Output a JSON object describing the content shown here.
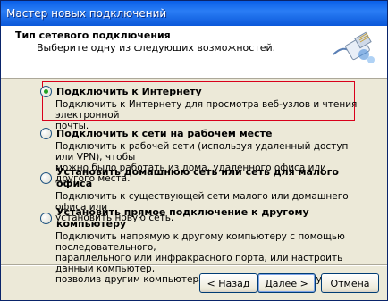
{
  "window": {
    "title": "Мастер новых подключений"
  },
  "header": {
    "title": "Тип сетевого подключения",
    "subtitle": "Выберите одну из следующих возможностей."
  },
  "options": [
    {
      "label": "Подключить к Интернету",
      "desc1": "Подключить к Интернету для просмотра веб-узлов и чтения  электронной",
      "desc2": "почты.",
      "desc3": "",
      "checked": true
    },
    {
      "label": "Подключить к сети на рабочем месте",
      "desc1": "Подключить к рабочей сети (используя удаленный доступ или VPN), чтобы",
      "desc2": "можно было работать из дома, удаленного офиса или другого места.",
      "desc3": "",
      "checked": false
    },
    {
      "label": "Установить домашнюю сеть или сеть для малого офиса",
      "desc1": "Подключить к существующей сети малого или домашнего офиса или",
      "desc2": "установить новую сеть.",
      "desc3": "",
      "checked": false
    },
    {
      "label": "Установить прямое подключение к другому компьютеру",
      "desc1": "Подключить напрямую к другому компьютеру с помощью последовательного,",
      "desc2": "параллельного или инфракрасного порта, или настроить данный компьютер,",
      "desc3": "позволив другим  компьютерам подключаться к нему.",
      "checked": false
    }
  ],
  "buttons": {
    "back": "< Назад",
    "next": "Далее >",
    "cancel": "Отмена"
  },
  "colors": {
    "highlight_border": "#d9001b",
    "titlebar": "#0a5fe8"
  },
  "icons": {
    "header": "network-cable-icon"
  }
}
